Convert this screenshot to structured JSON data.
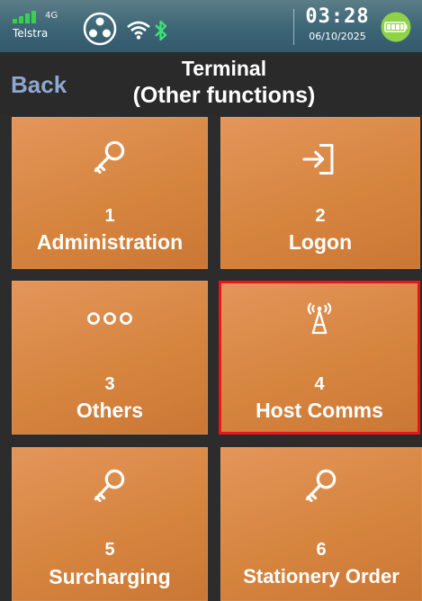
{
  "status_bar": {
    "network_type": "4G",
    "carrier": "Telstra",
    "time": "03:28",
    "date": "06/10/2025",
    "icons": [
      "signal-icon",
      "network-hub-icon",
      "wifi-icon",
      "bluetooth-icon",
      "battery-icon"
    ]
  },
  "header": {
    "back_label": "Back",
    "title_line1": "Terminal",
    "title_line2": "(Other functions)"
  },
  "tiles": [
    {
      "number": "1",
      "label": "Administration",
      "icon": "key-icon",
      "selected": false
    },
    {
      "number": "2",
      "label": "Logon",
      "icon": "login-arrow-icon",
      "selected": false
    },
    {
      "number": "3",
      "label": "Others",
      "icon": "more-dots-icon",
      "selected": false
    },
    {
      "number": "4",
      "label": "Host Comms",
      "icon": "antenna-icon",
      "selected": true
    },
    {
      "number": "5",
      "label": "Surcharging",
      "icon": "key-icon",
      "selected": false
    },
    {
      "number": "6",
      "label": "Stationery Order",
      "icon": "key-icon",
      "selected": false
    }
  ],
  "colors": {
    "tile": "#d6853f",
    "selection_outline": "#e8141e",
    "back_text": "#8ea8cf",
    "status_bar": "#3c6576",
    "background": "#2c2c2c"
  }
}
